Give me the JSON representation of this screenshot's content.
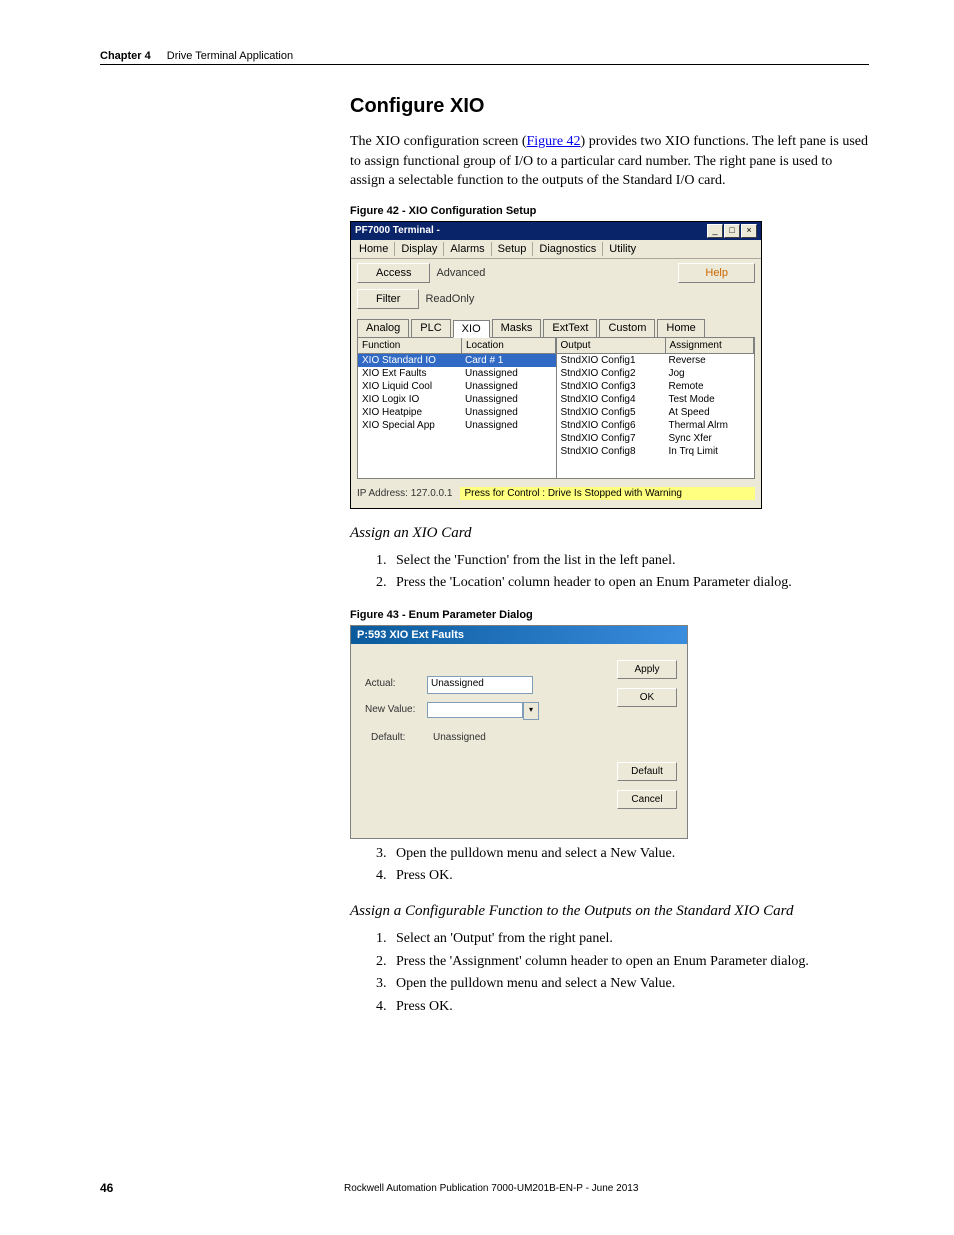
{
  "header": {
    "chapter": "Chapter 4",
    "title": "Drive Terminal Application"
  },
  "h2": "Configure XIO",
  "intro": "The XIO configuration screen (Figure 42) provides two XIO functions. The left pane is used to assign functional group of I/O to a particular card number. The right pane is used to assign a selectable function to the outputs of the Standard I/O card.",
  "figlink": "Figure 42",
  "fig42label": "Figure 42 - XIO Configuration Setup",
  "fig42": {
    "title": "PF7000 Terminal -",
    "menus": [
      "Home",
      "Display",
      "Alarms",
      "Setup",
      "Diagnostics",
      "Utility"
    ],
    "access_btn": "Access",
    "access_val": "Advanced",
    "filter_btn": "Filter",
    "filter_val": "ReadOnly",
    "help": "Help",
    "tabs": [
      "Analog",
      "PLC",
      "XIO",
      "Masks",
      "ExtText",
      "Custom",
      "Home"
    ],
    "left_headers": [
      "Function",
      "Location"
    ],
    "left_rows": [
      {
        "f": "XIO Standard IO",
        "l": "Card # 1",
        "sel": true
      },
      {
        "f": "XIO Ext Faults",
        "l": "Unassigned"
      },
      {
        "f": "XIO Liquid Cool",
        "l": "Unassigned"
      },
      {
        "f": "XIO Logix IO",
        "l": "Unassigned"
      },
      {
        "f": "XIO Heatpipe",
        "l": "Unassigned"
      },
      {
        "f": "XIO Special App",
        "l": "Unassigned"
      }
    ],
    "right_headers": [
      "Output",
      "Assignment"
    ],
    "right_rows": [
      {
        "o": "StndXIO Config1",
        "a": "Reverse"
      },
      {
        "o": "StndXIO Config2",
        "a": "Jog"
      },
      {
        "o": "StndXIO Config3",
        "a": "Remote"
      },
      {
        "o": "StndXIO Config4",
        "a": "Test Mode"
      },
      {
        "o": "StndXIO Config5",
        "a": "At Speed"
      },
      {
        "o": "StndXIO Config6",
        "a": "Thermal Alrm"
      },
      {
        "o": "StndXIO Config7",
        "a": "Sync Xfer"
      },
      {
        "o": "StndXIO Config8",
        "a": "In Trq Limit"
      }
    ],
    "ip": "IP Address: 127.0.0.1",
    "status": "Press for Control : Drive Is Stopped with Warning"
  },
  "assign_card": {
    "h": "Assign an XIO Card",
    "steps": [
      "Select the 'Function' from the list in the left panel.",
      "Press the 'Location' column header to open an Enum Parameter dialog."
    ]
  },
  "fig43label": "Figure 43 - Enum Parameter Dialog",
  "fig43": {
    "title": "P:593 XIO Ext Faults",
    "actual_lbl": "Actual:",
    "actual_val": "Unassigned",
    "newval_lbl": "New Value:",
    "default_lbl": "Default:",
    "default_val": "Unassigned",
    "apply": "Apply",
    "ok": "OK",
    "default_btn": "Default",
    "cancel": "Cancel"
  },
  "steps34": [
    "Open the pulldown menu and select a New Value.",
    "Press OK."
  ],
  "assign_out": {
    "h": "Assign a Configurable Function to the Outputs on the Standard XIO Card",
    "steps": [
      "Select an 'Output' from the right panel.",
      "Press the 'Assignment' column header to open an Enum Parameter dialog.",
      "Open the pulldown menu and select a New Value.",
      "Press OK."
    ]
  },
  "pageno": "46",
  "pub": "Rockwell Automation Publication 7000-UM201B-EN-P - June 2013"
}
